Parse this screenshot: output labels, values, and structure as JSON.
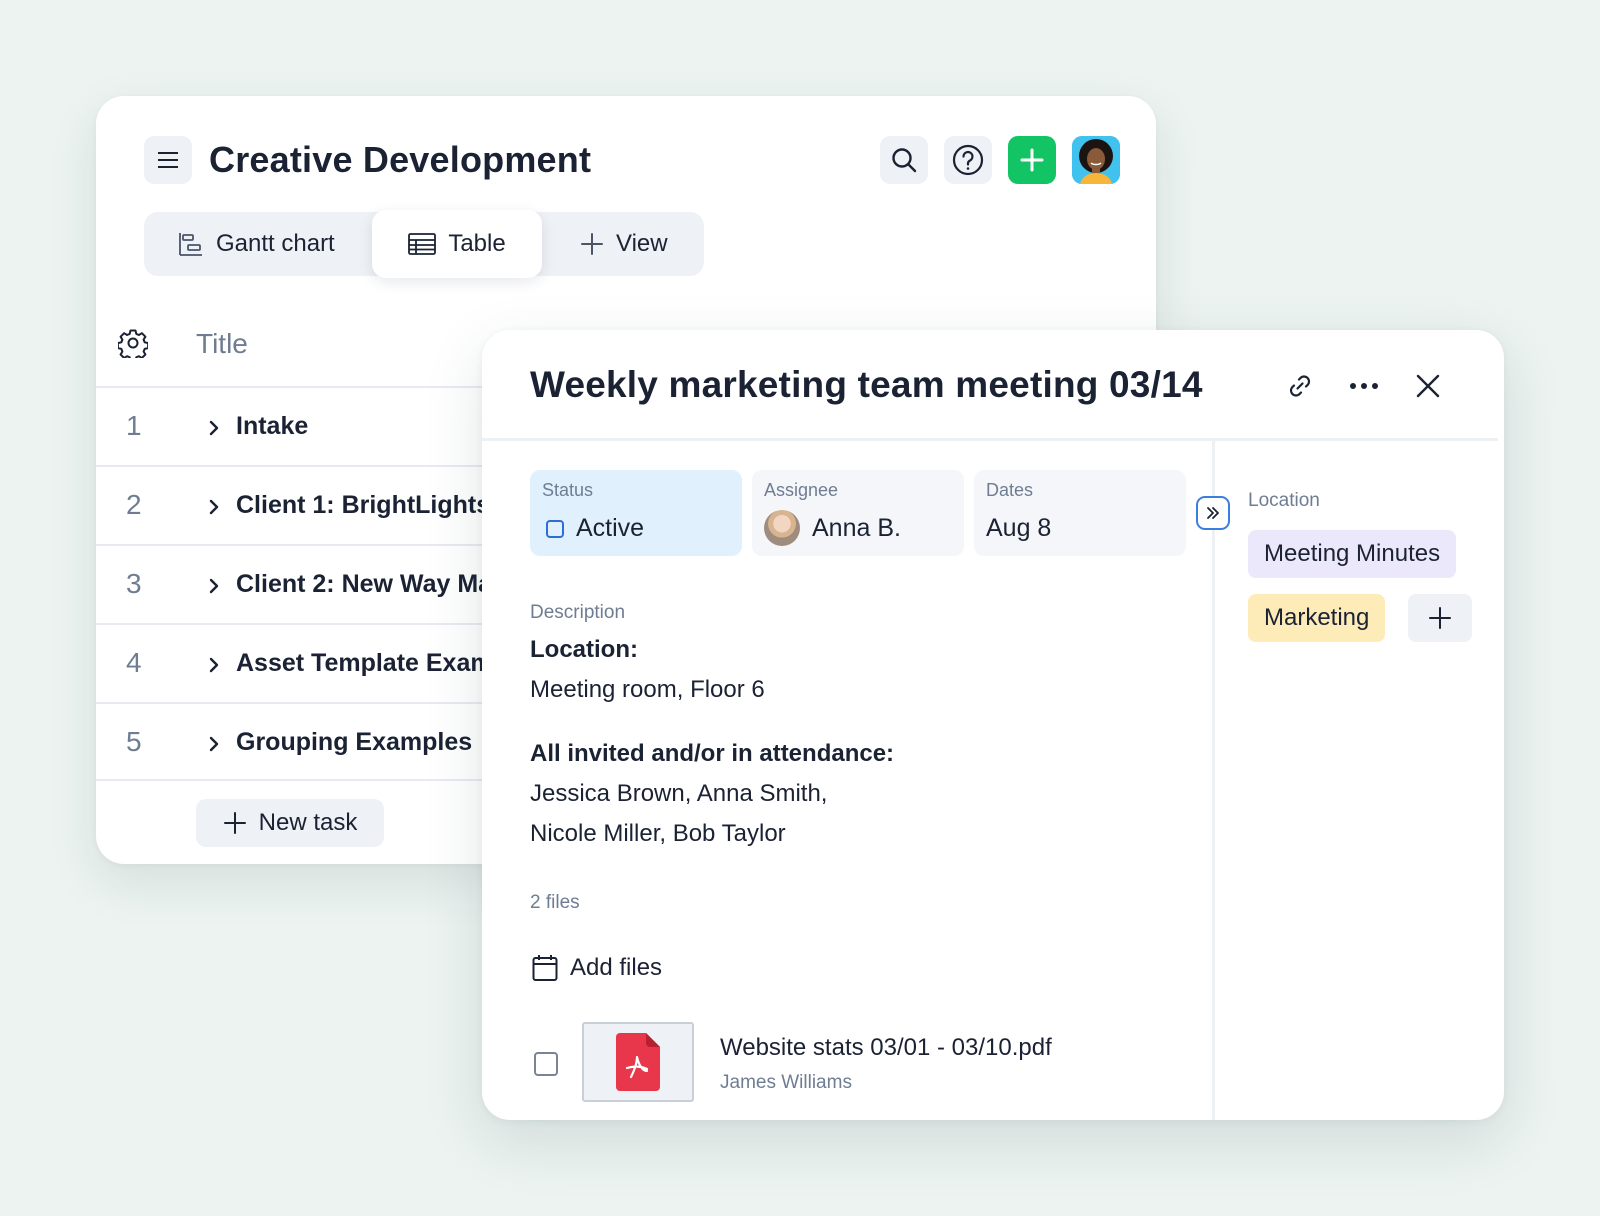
{
  "project": {
    "title": "Creative Development"
  },
  "view_tabs": [
    {
      "label": "Gantt chart",
      "icon": "gantt-icon"
    },
    {
      "label": "Table",
      "icon": "table-icon",
      "active": true
    },
    {
      "label": "View",
      "icon": "plus-icon"
    }
  ],
  "table": {
    "column_title": "Title",
    "rows": [
      {
        "num": "1",
        "title": "Intake"
      },
      {
        "num": "2",
        "title": "Client 1: BrightLights"
      },
      {
        "num": "3",
        "title": "Client 2: New Way Ma"
      },
      {
        "num": "4",
        "title": "Asset Template Exam"
      },
      {
        "num": "5",
        "title": "Grouping Examples"
      }
    ],
    "new_task_label": "New task"
  },
  "task": {
    "title": "Weekly marketing team meeting 03/14",
    "status_label": "Status",
    "status_value": "Active",
    "assignee_label": "Assignee",
    "assignee_value": "Anna B.",
    "dates_label": "Dates",
    "dates_value": "Aug 8",
    "description_label": "Description",
    "location_heading": "Location:",
    "location_text": "Meeting room, Floor 6",
    "attendance_heading": "All invited and/or in attendance:",
    "attendance_line1": "Jessica Brown, Anna Smith,",
    "attendance_line2": "Nicole Miller, Bob Taylor",
    "files_count": "2 files",
    "add_files_label": "Add files",
    "file": {
      "name": "Website stats 03/01 - 03/10.pdf",
      "author": "James Williams"
    },
    "side": {
      "location_label": "Location",
      "tags": [
        "Meeting Minutes",
        "Marketing"
      ]
    }
  },
  "colors": {
    "add_button": "#12c463",
    "status_bg": "#e1f0fd",
    "tag_meeting": "#ece8fb",
    "tag_marketing": "#fdebb8",
    "pdf_red": "#e8374a"
  }
}
